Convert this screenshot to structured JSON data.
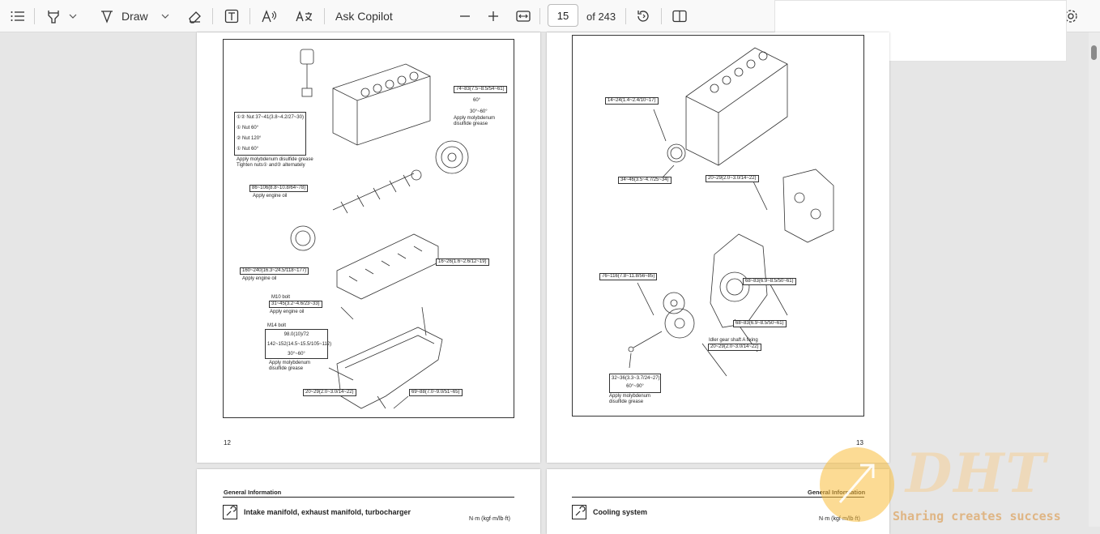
{
  "toolbar": {
    "draw_label": "Draw",
    "ask_copilot_label": "Ask Copilot",
    "page_number": "15",
    "page_total": "of 243"
  },
  "page12": {
    "page_number": "12",
    "labels": {
      "torque1": "74~83(7.5~8.5/54~61)",
      "angle1a": "60°",
      "angle1b": "30°~60°",
      "moly1": "Apply molybdenum",
      "moly1b": "disulfide grease",
      "nut1": "①② Nut 37~41(3.8~4.2/27~30)",
      "nut2": "① Nut 60°",
      "nut3": "② Nut 120°",
      "nut4": "① Nut 60°",
      "nut_note1": "Apply molybdenum disulfide grease",
      "nut_note2": "Tighten nuts① and② alternately",
      "torque2": "86~106(8.8~10.8/64~78)",
      "oil1": "Apply engine oil",
      "torque3": "16~26(1.6~2.6/12~19)",
      "torque4": "160~240(16.3~24.5/118~177)",
      "oil2": "Apply engine oil",
      "m10": "M10 bolt",
      "torque5": "31~45(3.2~4.6/23~33)",
      "oil3": "Apply engine oil",
      "m14": "M14 bolt",
      "m14a": "98.0(10)/72",
      "m14b": "142~152(14.5~15.5/105~112)",
      "m14c": "30°~60°",
      "moly2": "Apply molybdenum",
      "moly2b": "disulfide grease",
      "torque6": "20~29(2.0~3.0/14~22)",
      "torque7": "69~88(7.0~9.0/51~65)"
    }
  },
  "page13": {
    "page_number": "13",
    "labels": {
      "t1": "14~24(1.4~2.4/10~17)",
      "t2": "34~46(3.5~4.7/25~34)",
      "t3": "20~29(2.0~3.0/14~22)",
      "t4": "68~83(6.9~8.5/50~61)",
      "t5": "76~116(7.8~11.8/56~85)",
      "t6": "68~83(6.9~8.5/50~61)",
      "idler": "Idler gear shaft A fixing",
      "t7": "20~29(2.0~3.0/14~22)",
      "t8": "32~36(3.3~3.7/24~27)",
      "t8b": "60°~90°",
      "moly": "Apply molybdenum",
      "molyb": "disulfide grease"
    }
  },
  "page14": {
    "section": "General Information",
    "heading": "Intake manifold, exhaust manifold, turbocharger",
    "unit": "N·m (kgf·m/lb·ft)"
  },
  "page15": {
    "section": "General Information",
    "heading": "Cooling system",
    "unit": "N·m (kgf·m/lb·ft)"
  },
  "watermark": {
    "logo": "DHT",
    "slogan": "Sharing creates success"
  }
}
